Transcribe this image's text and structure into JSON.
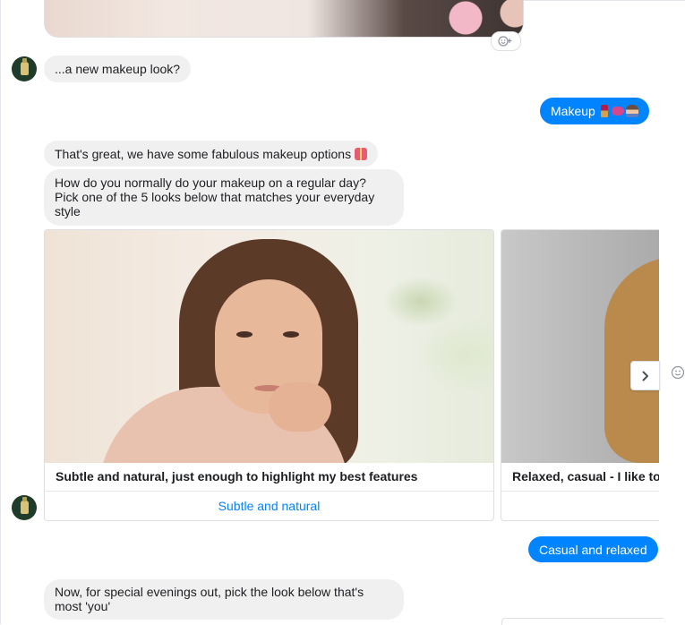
{
  "reaction_icon": "smiley-plus-icon",
  "messages": {
    "m1": "...a new makeup look?",
    "reply1": "Makeup",
    "m2": "That's great, we have some fabulous makeup options",
    "m3": "How do you normally do your makeup on a regular day? Pick one of the 5 looks below that matches your everyday style",
    "reply2": "Casual and relaxed",
    "m4": "Now, for special evenings out, pick the look below that's most 'you'"
  },
  "carousel": {
    "cards": [
      {
        "caption": "Subtle and natural, just enough to highlight my best features",
        "button": "Subtle and natural"
      },
      {
        "caption": "Relaxed, casual - I like to",
        "button": ""
      }
    ],
    "next_icon": "chevron-right-icon"
  },
  "colors": {
    "outgoing_bubble": "#0084ff",
    "incoming_bubble": "#f1f0f0",
    "link": "#0084ff"
  }
}
